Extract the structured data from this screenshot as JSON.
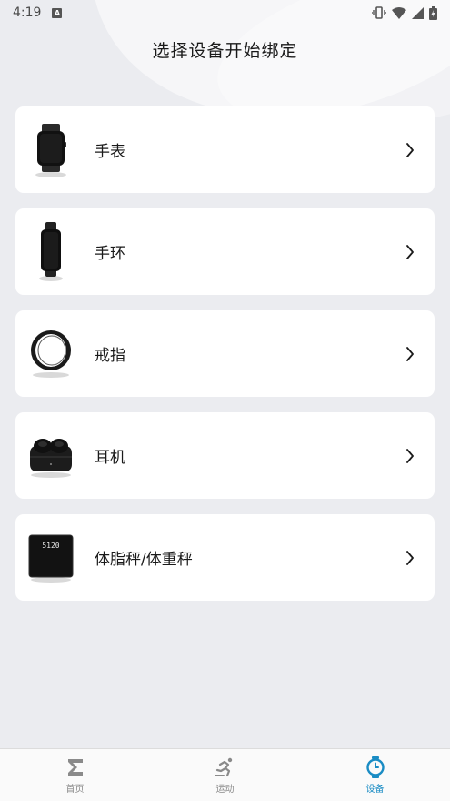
{
  "status_bar": {
    "time": "4:19",
    "notification_icon": "A"
  },
  "page": {
    "title": "选择设备开始绑定"
  },
  "devices": [
    {
      "label": "手表",
      "icon": "watch-icon"
    },
    {
      "label": "手环",
      "icon": "band-icon"
    },
    {
      "label": "戒指",
      "icon": "ring-icon"
    },
    {
      "label": "耳机",
      "icon": "earbuds-icon"
    },
    {
      "label": "体脂秤/体重秤",
      "icon": "scale-icon",
      "display_value": "5120"
    }
  ],
  "bottom_nav": {
    "items": [
      {
        "label": "首页",
        "icon": "sigma-icon"
      },
      {
        "label": "运动",
        "icon": "running-icon"
      },
      {
        "label": "设备",
        "icon": "watch-outline-icon",
        "active": true
      }
    ]
  },
  "colors": {
    "background": "#ebecf0",
    "card": "#ffffff",
    "accent": "#1a8cc4",
    "inactive": "#8a8a8a"
  }
}
